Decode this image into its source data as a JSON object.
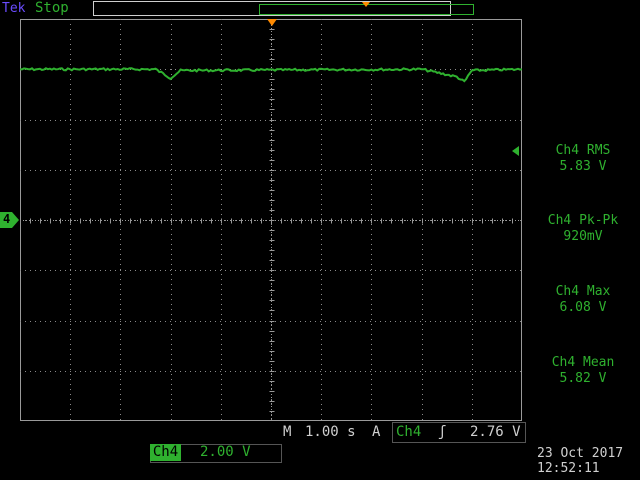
{
  "header": {
    "brand": "Tek",
    "acq_status": "Stop"
  },
  "channel_marker": "4",
  "measurements": [
    {
      "label": "Ch4 RMS",
      "value": "5.83 V"
    },
    {
      "label": "Ch4 Pk-Pk",
      "value": "920mV"
    },
    {
      "label": "Ch4 Max",
      "value": "6.08 V"
    },
    {
      "label": "Ch4 Mean",
      "value": "5.82 V"
    }
  ],
  "timebase": {
    "prefix": "M",
    "value": "1.00 s"
  },
  "trigger": {
    "mode": "A",
    "source": "Ch4",
    "slope_glyph": "ʃ",
    "level": "2.76 V"
  },
  "channel_scale": {
    "tag": "Ch4",
    "value": "2.00 V"
  },
  "datetime": {
    "date": "23 Oct  2017",
    "time": "12:52:11"
  },
  "colors": {
    "trace": "#2fb12f",
    "trigger_marker": "#ff8a00",
    "brand": "#6a4cff"
  },
  "icons": {
    "trigger_position": "orange-triangle-down",
    "trigger_level": "green-triangle-left",
    "ground_marker": "green-arrow-right"
  },
  "chart_data": {
    "type": "line",
    "title": "",
    "xlabel": "",
    "ylabel": "",
    "x_unit": "s",
    "x_per_div": 1.0,
    "y_unit": "V",
    "y_per_div": 2.0,
    "xlim": [
      -5,
      5
    ],
    "ylim": [
      -8,
      8
    ],
    "grid": true,
    "series": [
      {
        "x": [
          -5.0,
          -2.3,
          -2.0,
          -1.8,
          3.0,
          3.7,
          3.85,
          4.0,
          5.0
        ],
        "y": [
          6.0,
          6.0,
          5.65,
          5.95,
          6.0,
          5.7,
          5.5,
          5.95,
          6.0
        ]
      }
    ]
  }
}
